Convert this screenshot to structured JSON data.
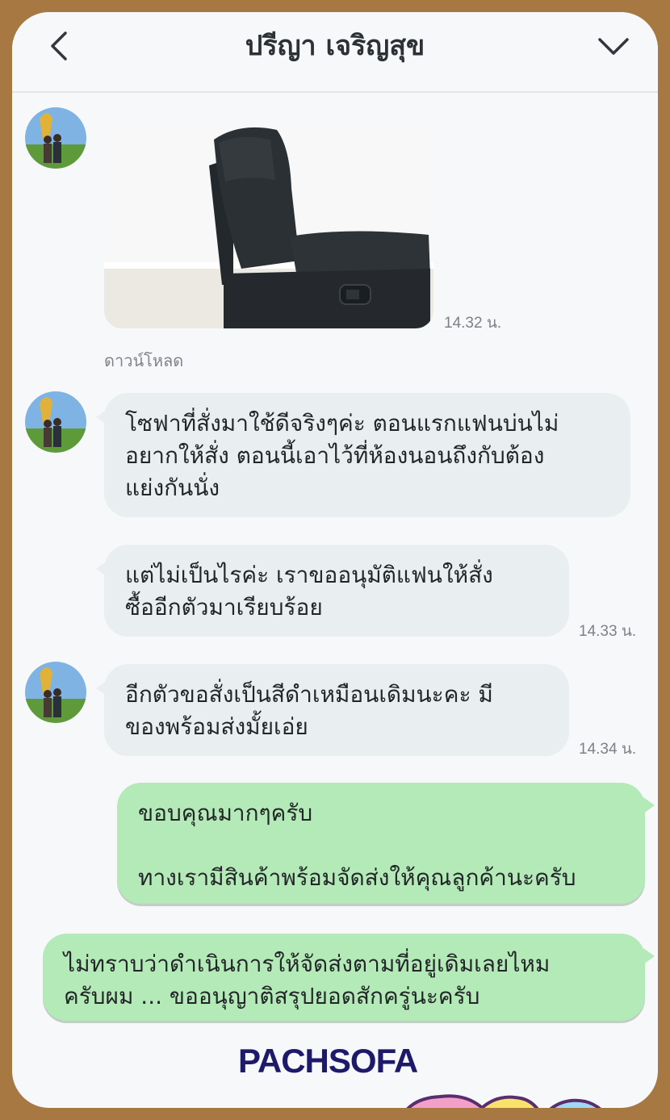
{
  "header": {
    "contact_name": "ปรีญา เจริญสุข",
    "back_icon": "chevron-left-icon",
    "menu_icon": "chevron-down-icon"
  },
  "messages": [
    {
      "type": "image",
      "sender": "incoming",
      "time": "14.32 น.",
      "download_label": "ดาวน์โหลด"
    },
    {
      "type": "text",
      "sender": "incoming",
      "text": "โซฟาที่สั่งมาใช้ดีจริงๆค่ะ ตอนแรกแฟนบ่นไม่\nอยากให้สั่ง ตอนนี้เอาไว้ที่ห้องนอนถึงกับต้อง\nแย่งกันนั่ง"
    },
    {
      "type": "text",
      "sender": "incoming",
      "text": "แต่ไม่เป็นไรค่ะ เราขออนุมัติแฟนให้สั่ง\nซื้ออีกตัวมาเรียบร้อย",
      "time": "14.33 น."
    },
    {
      "type": "text",
      "sender": "incoming",
      "text": "อีกตัวขอสั่งเป็นสีดำเหมือนเดิมนะคะ มี\nของพร้อมส่งมั้ยเอ่ย",
      "time": "14.34 น."
    },
    {
      "type": "text",
      "sender": "outgoing",
      "text": "ขอบคุณมากๆครับ\n\nทางเรามีสินค้าพร้อมจัดส่งให้คุณลูกค้านะครับ"
    },
    {
      "type": "text",
      "sender": "outgoing",
      "text": "ไม่ทราบว่าดำเนินการให้จัดส่งตามที่อยู่เดิมเลยไหม\nครับผม ... ขออนุญาติสรุปยอดสักครู่นะครับ"
    }
  ],
  "branding": {
    "logo_text": "PACHSOFA"
  },
  "colors": {
    "frame": "#a87843",
    "incoming_bubble": "#e9eef0",
    "outgoing_bubble": "#b4eab7",
    "logo": "#1e1a6b"
  }
}
